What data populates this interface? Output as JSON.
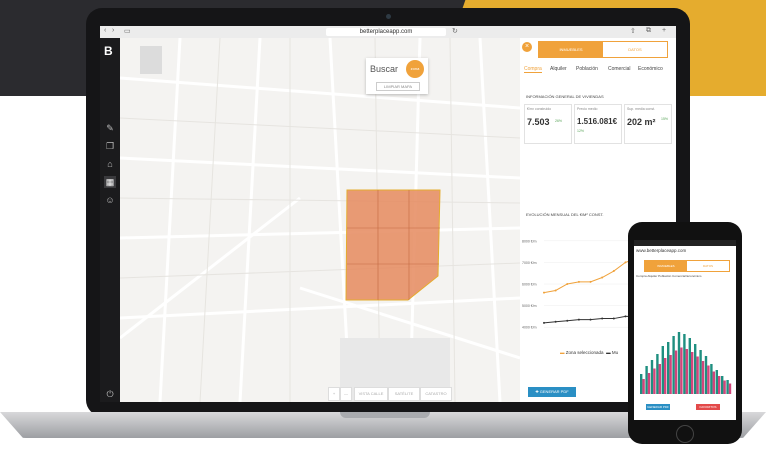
{
  "browser": {
    "url": "betterplaceapp.com"
  },
  "app": {
    "logo": "B",
    "map": {
      "search_label": "Buscar",
      "search_button": "zona",
      "clear_button": "LIMPIAR MAPA",
      "controls": [
        "+",
        "—",
        "VISTA CALLE",
        "SATÉLITE",
        "CATASTRO"
      ]
    },
    "panel": {
      "toggle": {
        "active": "INMUEBLES",
        "inactive": "DATOS"
      },
      "tabs": [
        "Compra",
        "Alquiler",
        "Población",
        "Comercial",
        "Económico"
      ],
      "info_title": "INFORMACIÓN GENERAL DE VIVIENDAS",
      "stats": [
        {
          "label": "€/m² construido",
          "value": "7.503",
          "change": "26%"
        },
        {
          "label": "Precio medio",
          "value": "1.516.081€",
          "change": "12%"
        },
        {
          "label": "Sup. media const.",
          "value": "202 m²",
          "change": "15%"
        }
      ],
      "chart_title": "EVOLUCIÓN MENSUAL DEL €/M² CONST.",
      "legend": {
        "zone": "Zona seleccionada",
        "municipality": "Mu"
      },
      "pdf_button": "GENERAR PDF"
    }
  },
  "phone": {
    "url": "www.betterplaceapp.com",
    "toggle": {
      "active": "INMUEBLES",
      "inactive": "DATOS"
    },
    "tabs": "Compra   Alquiler   Población   Comercial   Económico",
    "btn_blue": "GENERAR PDF",
    "btn_red": "FAVORITOS"
  },
  "colors": {
    "accent": "#f0a23b",
    "zone": "#e58a5e",
    "blue": "#2a8fc4",
    "red": "#e34a4a"
  },
  "chart_data": {
    "type": "line",
    "yticks": [
      "4000 €/m",
      "5000 €/m",
      "6000 €/m",
      "7000 €/m",
      "8000 €/m"
    ],
    "ylim": [
      3500,
      8500
    ],
    "series": [
      {
        "name": "Zona seleccionada",
        "values": [
          5600,
          5700,
          6000,
          6100,
          6100,
          6300,
          6600,
          7000,
          7200,
          7400,
          7600,
          8000
        ]
      },
      {
        "name": "Mu",
        "values": [
          4200,
          4250,
          4300,
          4350,
          4350,
          4400,
          4400,
          4500,
          4500,
          4550,
          4600,
          4700
        ]
      }
    ]
  }
}
